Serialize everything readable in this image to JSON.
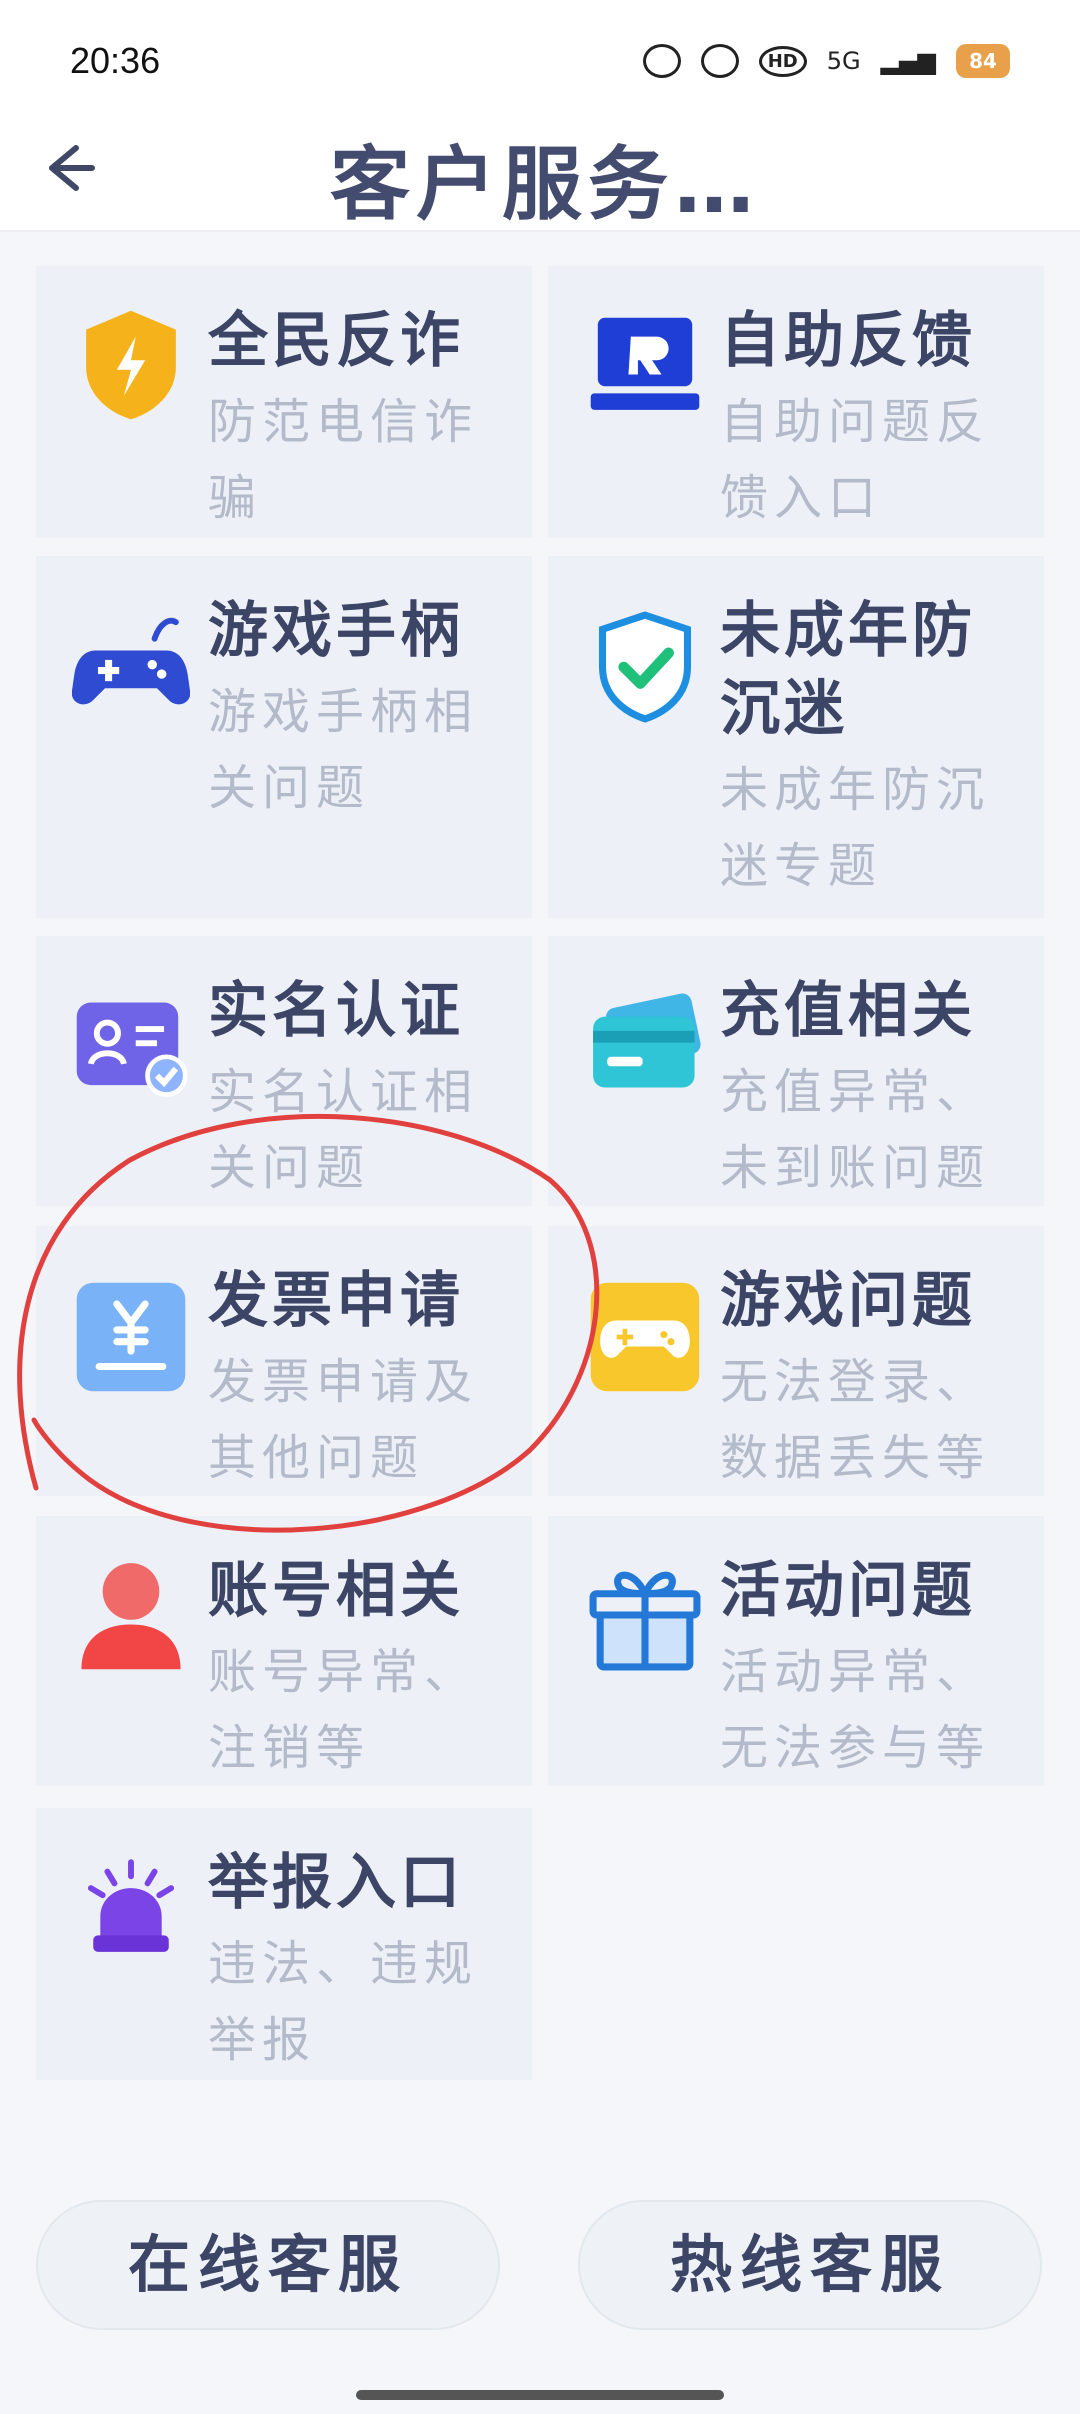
{
  "status_bar": {
    "time": "20:36",
    "network": "5G",
    "battery": "84"
  },
  "header": {
    "title": "客户服务…"
  },
  "services": [
    {
      "title": "全民反诈",
      "desc": "防范电信诈骗",
      "icon": "shield-lightning-icon"
    },
    {
      "title": "自助反馈",
      "desc": "自助问题反馈入口",
      "icon": "feedback-monitor-icon"
    },
    {
      "title": "游戏手柄",
      "desc": "游戏手柄相关问题",
      "icon": "gamepad-icon"
    },
    {
      "title": "未成年防沉迷",
      "desc": "未成年防沉迷专题",
      "icon": "shield-check-icon"
    },
    {
      "title": "实名认证",
      "desc": "实名认证相关问题",
      "icon": "id-card-icon"
    },
    {
      "title": "充值相关",
      "desc": "充值异常、未到账问题",
      "icon": "credit-card-icon"
    },
    {
      "title": "发票申请",
      "desc": "发票申请及其他问题",
      "icon": "invoice-yen-icon"
    },
    {
      "title": "游戏问题",
      "desc": "无法登录、数据丢失等",
      "icon": "game-controller-icon"
    },
    {
      "title": "账号相关",
      "desc": "账号异常、注销等",
      "icon": "user-icon"
    },
    {
      "title": "活动问题",
      "desc": "活动异常、无法参与等",
      "icon": "gift-icon"
    },
    {
      "title": "举报入口",
      "desc": "违法、违规举报",
      "icon": "alarm-siren-icon"
    }
  ],
  "buttons": {
    "online": "在线客服",
    "hotline": "热线客服"
  },
  "colors": {
    "annotation": "#e0413f",
    "title": "#434c6e",
    "desc": "#b3bac9"
  }
}
